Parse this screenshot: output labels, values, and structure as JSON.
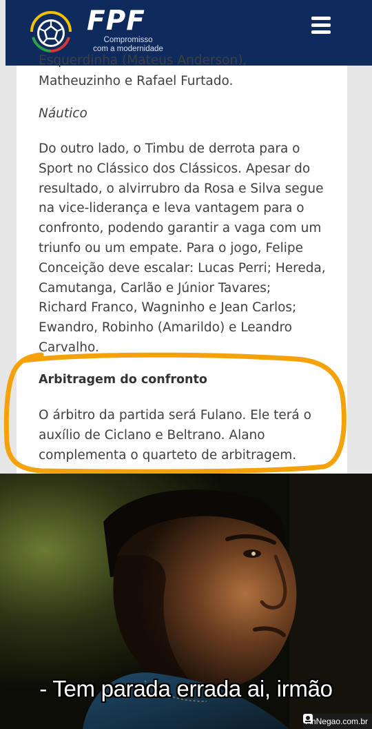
{
  "header": {
    "brand_name": "FPF",
    "tagline_line1": "Compromisso",
    "tagline_line2": "com a modernidade",
    "menu_icon": "hamburger-menu-icon",
    "background_color": "#0f2a5c"
  },
  "article": {
    "cut_line": "Esquerdinha (Mateus Anderson),",
    "sport_end_line": "Matheuzinho e Rafael Furtado.",
    "nautico_heading": "Náutico",
    "nautico_paragraph_lines": [
      "Do outro lado, o Timbu de derrota para o",
      "Sport no Clássico dos Clássicos. Apesar do",
      "resultado, o alvirrubro da Rosa e Silva segue",
      "na vice-liderança e leva vantagem para o",
      "confronto, podendo garantir a vaga com um",
      "triunfo ou um empate. Para o jogo, Felipe",
      "Conceição deve escalar: Lucas Perri; Hereda,",
      "Camutanga, Carlão e Júnior Tavares;",
      "Richard Franco, Wagninho e Jean Carlos;",
      "Ewandro, Robinho (Amarildo) e Leandro",
      "Carvalho."
    ],
    "arbitragem_heading": "Arbitragem do confronto",
    "arbitragem_paragraph_lines": [
      "O árbitro da partida será Fulano. Ele terá o",
      "auxílio de Ciclano e Beltrano. Alano",
      "complementa o quarteto de arbitragem."
    ],
    "highlight_color": "#f5a20a"
  },
  "meme": {
    "caption": "- Tem parada errada ai, irmão",
    "watermark": "AhNegao.com.br"
  }
}
